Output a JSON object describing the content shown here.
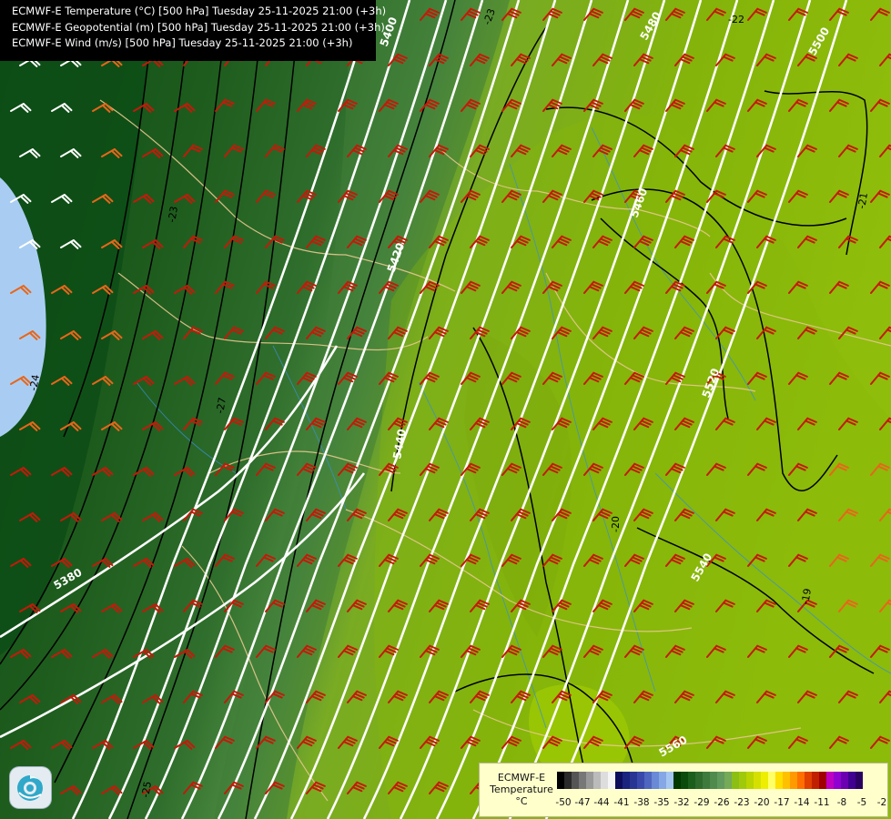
{
  "title_lines": [
    "ECMWF-E Temperature (°C) [500 hPa] Tuesday 25-11-2025 21:00 (+3h)",
    "ECMWF-E Geopotential (m) [500 hPa] Tuesday 25-11-2025 21:00 (+3h)",
    "ECMWF-E Wind (m/s) [500 hPa] Tuesday 25-11-2025 21:00 (+3h)"
  ],
  "legend": {
    "title_line1": "ECMWF-E",
    "title_line2": "Temperature",
    "unit": "°C",
    "ticks": [
      "-50",
      "-47",
      "-44",
      "-41",
      "-38",
      "-35",
      "-32",
      "-29",
      "-26",
      "-23",
      "-20",
      "-17",
      "-14",
      "-11",
      "-8",
      "-5",
      "-2"
    ],
    "colors": [
      "#000000",
      "#2a2a2a",
      "#555555",
      "#777777",
      "#999999",
      "#bbbbbb",
      "#dddddd",
      "#f5f5f5",
      "#0d0d5c",
      "#1a237e",
      "#283593",
      "#3949ab",
      "#4f66c0",
      "#6a89d6",
      "#86a7e6",
      "#a6c6f2",
      "#003800",
      "#0a4a0a",
      "#1b5e1b",
      "#2d6a2c",
      "#3e7a3c",
      "#508a4c",
      "#62995c",
      "#74aa58",
      "#8cbf14",
      "#9fc90a",
      "#b9d400",
      "#d6e000",
      "#eeee00",
      "#ffff66",
      "#ffe000",
      "#ffc000",
      "#ff9a00",
      "#ff7000",
      "#e04000",
      "#c02000",
      "#a00000",
      "#c000c0",
      "#9000d0",
      "#6a00b0",
      "#400090",
      "#2a0060"
    ]
  },
  "geopotential_labels": [
    "5400",
    "5480",
    "5500",
    "5420",
    "5380",
    "5440",
    "5460",
    "5520",
    "5540",
    "5560"
  ],
  "temperature_labels": [
    "-23",
    "-22",
    "-23",
    "-20",
    "-25",
    "-27",
    "-24",
    "-21",
    "-19"
  ],
  "colors": {
    "barb_red": "#c41a0a",
    "barb_orange": "#e8661a",
    "barb_white": "#ffffff",
    "geo_contour": "#ffffff",
    "temp_contour": "#000000",
    "border": "#e8c890",
    "river": "#3a8fd0"
  },
  "icons": [
    "ecmwf-logo-icon"
  ]
}
